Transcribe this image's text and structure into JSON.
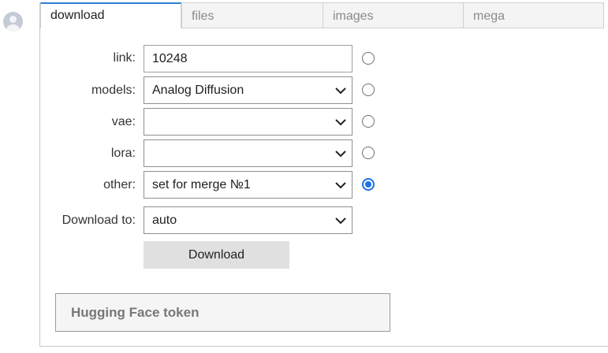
{
  "tabs": [
    {
      "label": "download",
      "active": true
    },
    {
      "label": "files",
      "active": false
    },
    {
      "label": "images",
      "active": false
    },
    {
      "label": "mega",
      "active": false
    }
  ],
  "form": {
    "link": {
      "label": "link:",
      "value": "10248",
      "selected": false
    },
    "models": {
      "label": "models:",
      "value": "Analog Diffusion",
      "selected": false
    },
    "vae": {
      "label": "vae:",
      "value": "",
      "selected": false
    },
    "lora": {
      "label": "lora:",
      "value": "",
      "selected": false
    },
    "other": {
      "label": "other:",
      "value": "set for merge №1",
      "selected": true
    },
    "download_to": {
      "label": "Download to:",
      "value": "auto"
    }
  },
  "download_button": "Download",
  "token": {
    "placeholder": "Hugging Face token"
  },
  "colors": {
    "accent": "#1a73e8",
    "tab_active_border": "#2d7fd6",
    "button_bg": "#e0e0e0"
  },
  "icons": [
    "avatar-icon",
    "chevron-down-icon"
  ]
}
